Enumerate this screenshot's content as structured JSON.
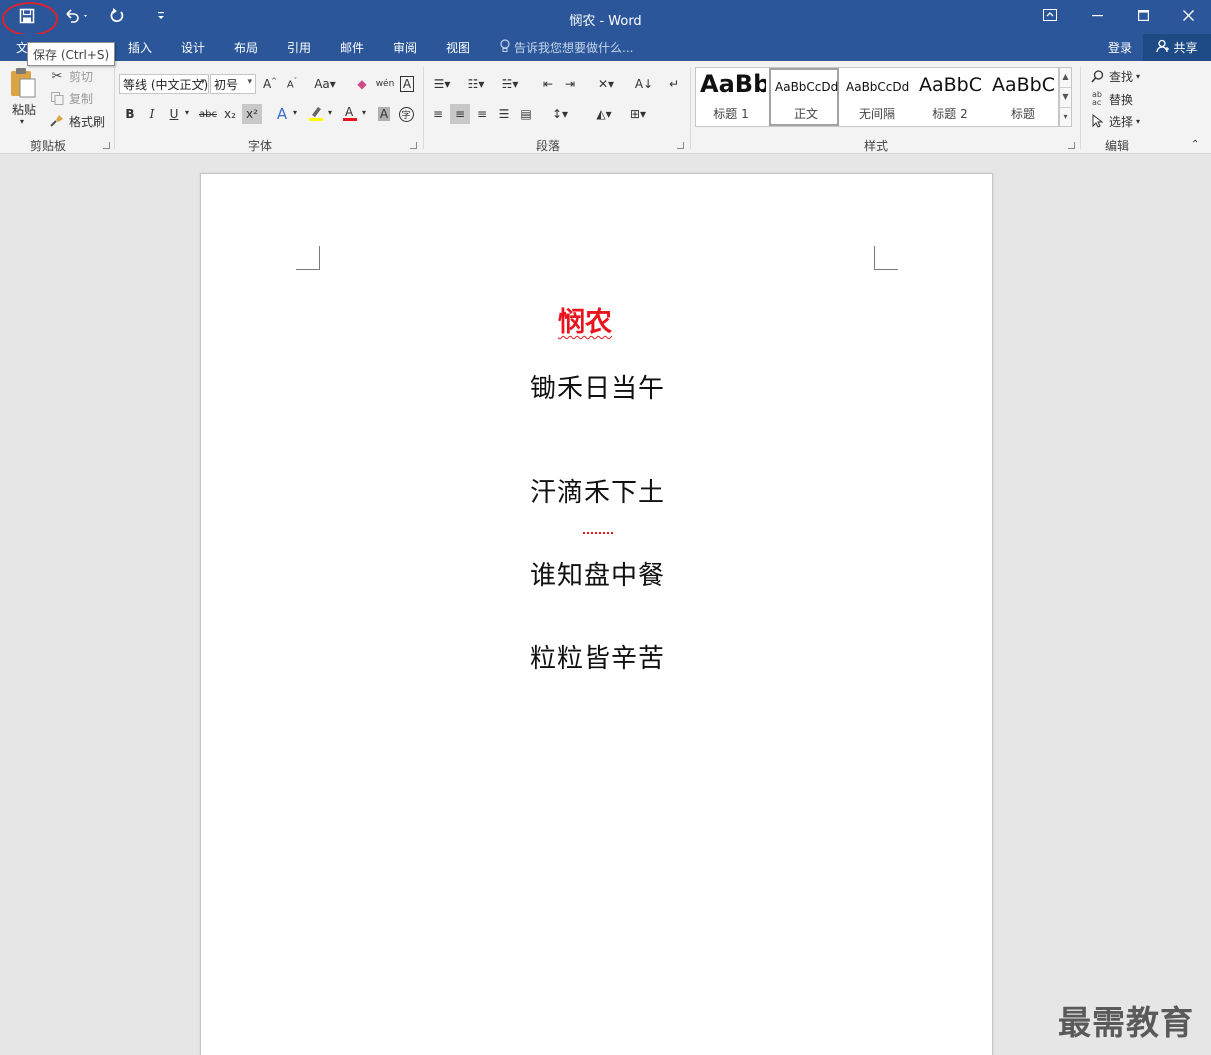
{
  "window": {
    "title": "悯农 - Word",
    "controls": {
      "restore_ribbon": "⧉",
      "minimize": "—",
      "maximize": "☐",
      "close": "✕"
    }
  },
  "qat": {
    "save_icon": "save-icon",
    "undo_icon": "undo-icon",
    "redo_icon": "redo-icon",
    "customize_icon": "customize-qat-icon"
  },
  "tooltip": {
    "text": "保存 (Ctrl+S)"
  },
  "tabs": [
    {
      "label": "文"
    },
    {
      "label": "插入"
    },
    {
      "label": "设计"
    },
    {
      "label": "布局"
    },
    {
      "label": "引用"
    },
    {
      "label": "邮件"
    },
    {
      "label": "审阅"
    },
    {
      "label": "视图"
    }
  ],
  "tell_me": {
    "placeholder": "告诉我您想要做什么..."
  },
  "account": {
    "login": "登录",
    "share": "共享"
  },
  "ribbon": {
    "clipboard": {
      "label": "剪贴板",
      "paste": "粘贴",
      "cut": "剪切",
      "copy": "复制",
      "format_painter": "格式刷"
    },
    "font": {
      "label": "字体",
      "font_name": "等线 (中文正文)",
      "font_size": "初号",
      "bold": "B",
      "italic": "I",
      "underline": "U",
      "strike": "abc",
      "subscript": "x₂",
      "superscript": "x²",
      "font_color": "#e8151f",
      "highlight_color": "#ffff00"
    },
    "paragraph": {
      "label": "段落"
    },
    "styles": {
      "label": "样式",
      "items": [
        {
          "preview": "AaBb",
          "label": "标题 1"
        },
        {
          "preview": "AaBbCcDd",
          "label": "正文"
        },
        {
          "preview": "AaBbCcDd",
          "label": "无间隔"
        },
        {
          "preview": "AaBbC",
          "label": "标题 2"
        },
        {
          "preview": "AaBbC",
          "label": "标题"
        }
      ]
    },
    "editing": {
      "label": "编辑",
      "find": "查找",
      "replace": "替换",
      "select": "选择"
    }
  },
  "document": {
    "title": "悯农",
    "lines": [
      "锄禾日当午",
      "汗滴禾下土",
      "谁知盘中餐",
      "粒粒皆辛苦"
    ],
    "title_color": "#e8151f"
  },
  "watermark": "最需教育",
  "colors": {
    "titlebar": "#2b579a",
    "ribbon": "#f3f3f3",
    "canvas": "#e6e6e6"
  }
}
